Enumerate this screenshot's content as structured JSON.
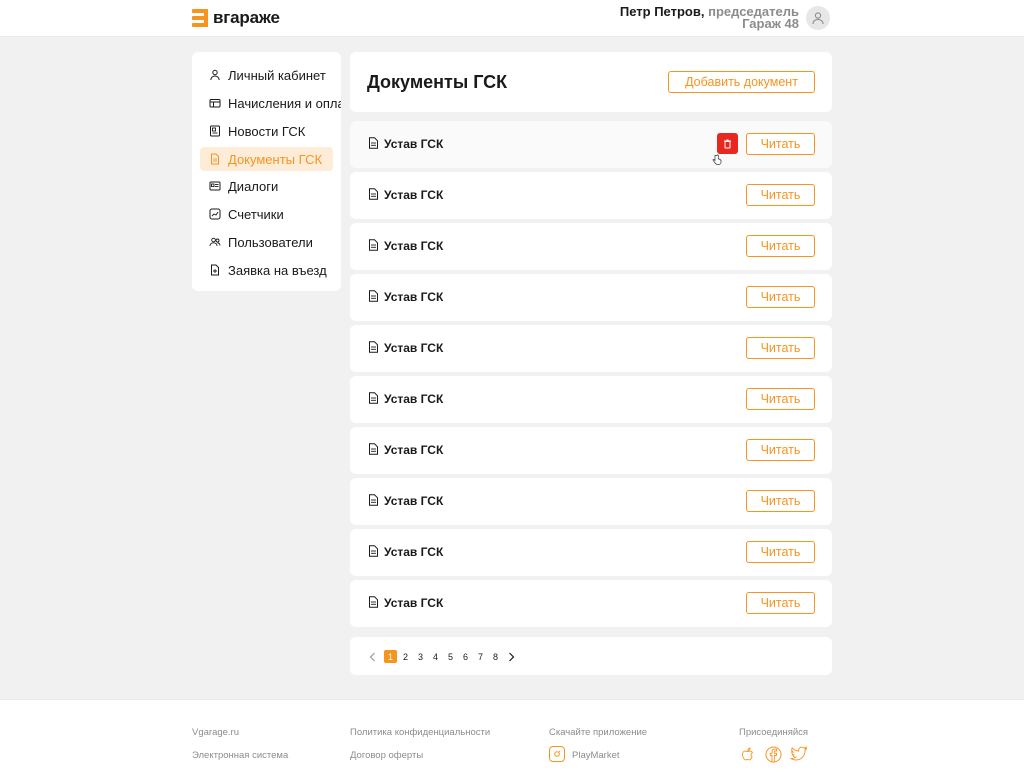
{
  "header": {
    "logo_text": "вгараже",
    "user_name": "Петр Петров,",
    "user_role": "председатель",
    "garage": "Гараж 48"
  },
  "sidebar": {
    "items": [
      {
        "label": "Личный кабинет",
        "icon": "user-icon",
        "active": false
      },
      {
        "label": "Начисления и оплаты",
        "icon": "wallet-icon",
        "active": false
      },
      {
        "label": "Новости ГСК",
        "icon": "news-icon",
        "active": false
      },
      {
        "label": "Документы ГСК",
        "icon": "document-icon",
        "active": true
      },
      {
        "label": "Диалоги",
        "icon": "chat-icon",
        "active": false
      },
      {
        "label": "Счетчики",
        "icon": "meter-icon",
        "active": false
      },
      {
        "label": "Пользователи",
        "icon": "users-icon",
        "active": false
      },
      {
        "label": "Заявка на въезд",
        "icon": "entry-request-icon",
        "active": false
      }
    ]
  },
  "main": {
    "title": "Документы ГСК",
    "add_button": "Добавить документ",
    "read_label": "Читать",
    "documents": [
      {
        "name": "Устав ГСК"
      },
      {
        "name": "Устав ГСК"
      },
      {
        "name": "Устав ГСК"
      },
      {
        "name": "Устав ГСК"
      },
      {
        "name": "Устав ГСК"
      },
      {
        "name": "Устав ГСК"
      },
      {
        "name": "Устав ГСК"
      },
      {
        "name": "Устав ГСК"
      },
      {
        "name": "Устав ГСК"
      },
      {
        "name": "Устав ГСК"
      }
    ]
  },
  "pagination": {
    "pages": [
      "1",
      "2",
      "3",
      "4",
      "5",
      "6",
      "7",
      "8"
    ],
    "current": "1"
  },
  "footer": {
    "col1": [
      "Vgarage.ru",
      "Электронная система"
    ],
    "col2": [
      "Политика конфиденциальности",
      "Договор оферты"
    ],
    "app_title": "Скачайте приложение",
    "app_store": "PlayMarket",
    "join_title": "Присоединяйся",
    "social_icons": [
      "apple-icon",
      "facebook-icon",
      "twitter-icon"
    ]
  },
  "colors": {
    "accent": "#f7941d",
    "danger": "#e8281e",
    "background": "#f1f1f1"
  }
}
